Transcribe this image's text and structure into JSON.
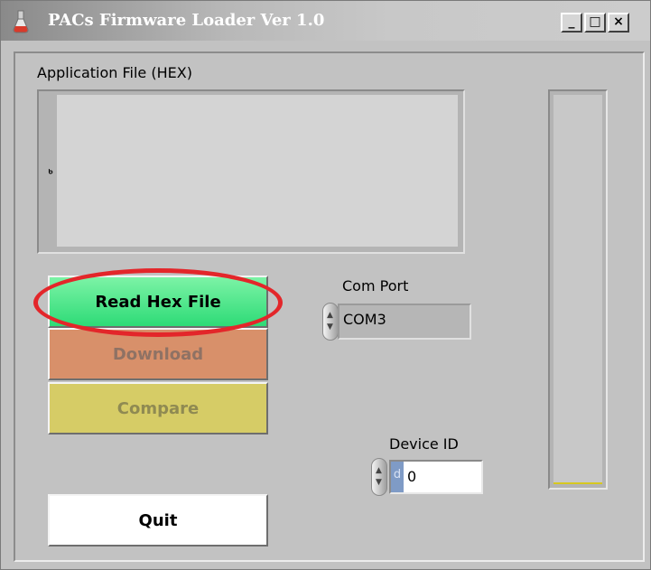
{
  "window": {
    "title": "PACs Firmware Loader Ver 1.0",
    "minimize_glyph": "_",
    "maximize_glyph": "□",
    "close_glyph": "×",
    "icon": "flask-icon"
  },
  "application_file": {
    "label": "Application File (HEX)",
    "content": "ᒃ"
  },
  "buttons": {
    "read_hex": "Read Hex File",
    "download": "Download",
    "compare": "Compare",
    "quit": "Quit"
  },
  "com_port": {
    "label": "Com Port",
    "value": "COM3"
  },
  "device_id": {
    "label": "Device ID",
    "radix": "d",
    "value": "0"
  },
  "progress": {
    "level": 0
  },
  "colors": {
    "read_hex_button": "#3be483",
    "download_button": "#d8906a",
    "compare_button": "#d6cc66",
    "highlight_ring": "#e3262a",
    "progress_fill": "#d7c820"
  }
}
